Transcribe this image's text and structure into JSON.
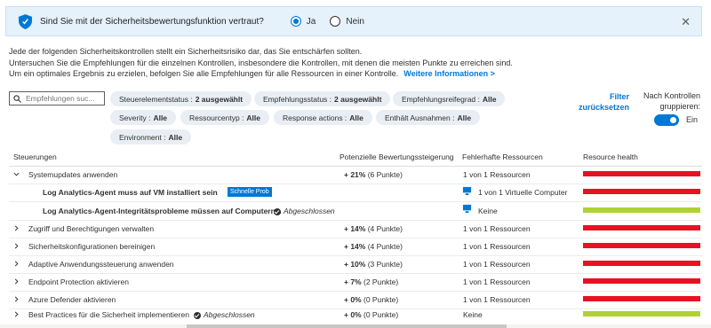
{
  "banner": {
    "question": "Sind Sie mit der Sicherheitsbewertungsfunktion vertraut?",
    "yes_label": "Ja",
    "no_label": "Nein",
    "selected": "Ja"
  },
  "intro": {
    "line1": "Jede der folgenden Sicherheitskontrollen stellt ein Sicherheitsrisiko dar, das Sie entschärfen sollten.",
    "line2": "Untersuchen Sie die Empfehlungen für die einzelnen Kontrollen, insbesondere die Kontrollen, mit denen die meisten Punkte zu erreichen sind.",
    "line3": "Um ein optimales Ergebnis zu erzielen, befolgen Sie alle Empfehlungen für alle Ressourcen in einer Kontrolle.",
    "link": "Weitere Informationen >"
  },
  "search": {
    "placeholder": "Empfehlungen suc..."
  },
  "filters": [
    {
      "label": "Steuerelementstatus :",
      "value": "2 ausgewählt"
    },
    {
      "label": "Empfehlungsstatus :",
      "value": "2 ausgewählt"
    },
    {
      "label": "Empfehlungsreifegrad :",
      "value": "Alle"
    },
    {
      "label": "Severity :",
      "value": "Alle"
    },
    {
      "label": "Ressourcentyp :",
      "value": "Alle"
    },
    {
      "label": "Response actions :",
      "value": "Alle"
    },
    {
      "label": "Enthält Ausnahmen :",
      "value": "Alle"
    },
    {
      "label": "Environment :",
      "value": "Alle"
    }
  ],
  "reset": {
    "line1": "Filter",
    "line2": "zurücksetzen"
  },
  "grouping": {
    "line1": "Nach Kontrollen",
    "line2": "gruppieren:",
    "toggle_label": "Ein",
    "on": true
  },
  "table": {
    "headers": [
      "Steuerungen",
      "Potenzielle Bewertungssteigerung",
      "Fehlerhafte Ressourcen",
      "Resource health"
    ],
    "rows": [
      {
        "name": "Systemupdates anwenden",
        "gain": "+ 21%",
        "points": "(6 Punkte)",
        "resources": "1 von 1 Ressourcen",
        "health": "red",
        "expanded": true
      },
      {
        "name": "Log Analytics-Agent muss auf VM installiert sein",
        "badge": "Schnelle Prob",
        "resources": "1 von 1 Virtuelle Computer",
        "health": "red",
        "child": true
      },
      {
        "name": "Log Analytics-Agent-Integritätsprobleme müssen auf Computern...",
        "status": "Abgeschlossen",
        "resources": "Keine",
        "health": "green",
        "child": true
      },
      {
        "name": "Zugriff und Berechtigungen verwalten",
        "gain": "+ 14%",
        "points": "(4 Punkte)",
        "resources": "1 von 1 Ressourcen",
        "health": "red"
      },
      {
        "name": "Sicherheitskonfigurationen bereinigen",
        "gain": "+ 14%",
        "points": "(4 Punkte)",
        "resources": "1 von 1 Ressourcen",
        "health": "red"
      },
      {
        "name": "Adaptive Anwendungssteuerung anwenden",
        "gain": "+ 10%",
        "points": "(3 Punkte)",
        "resources": "1 von 1 Ressourcen",
        "health": "red"
      },
      {
        "name": "Endpoint Protection aktivieren",
        "gain": "+ 7%",
        "points": "(2 Punkte)",
        "resources": "1 von 1 Ressourcen",
        "health": "red"
      },
      {
        "name": "Azure Defender aktivieren",
        "gain": "+ 0%",
        "points": "(0 Punkte)",
        "resources": "1 von 1 Ressourcen",
        "health": "red"
      },
      {
        "name": "Best Practices für die Sicherheit implementieren",
        "status": "Abgeschlossen",
        "gain": "+ 0%",
        "points": "(0 Punkte)",
        "resources": "Keine",
        "health": "green"
      }
    ]
  },
  "colors": {
    "accent": "#0078d4",
    "unhealthy": "#e81123",
    "healthy": "#b0d136",
    "banner_bg": "#e5f1fb"
  }
}
